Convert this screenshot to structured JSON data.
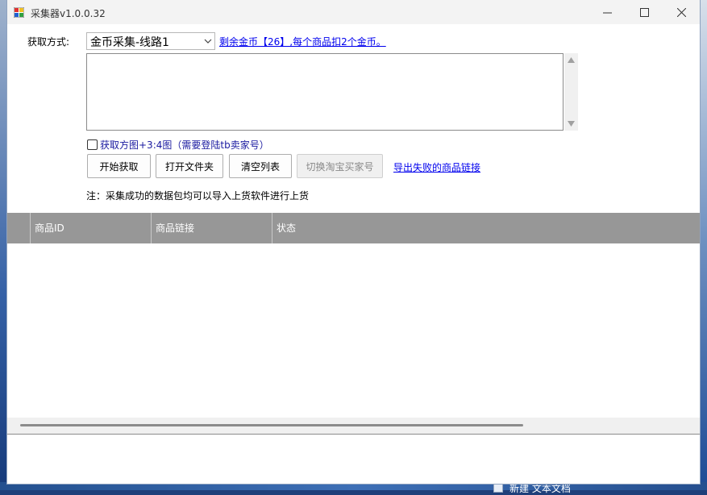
{
  "window": {
    "title": "采集器v1.0.0.32",
    "controls": {
      "minimize": "minimize-icon",
      "maximize": "maximize-icon",
      "close": "close-icon"
    }
  },
  "form": {
    "method_label": "获取方式:",
    "method_selected": "金币采集-线路1",
    "coins_link": "剩余金币【26】,每个商品扣2个金币。",
    "input_text": "",
    "checkbox_label": "获取方图+3:4图（需要登陆tb卖家号）",
    "checkbox_checked": false
  },
  "buttons": {
    "start": "开始获取",
    "open_folder": "打开文件夹",
    "clear_list": "清空列表",
    "switch_account": "切换淘宝买家号",
    "export_failed": "导出失败的商品链接"
  },
  "note": "注：采集成功的数据包均可以导入上货软件进行上货",
  "table": {
    "columns": [
      "",
      "商品ID",
      "商品链接",
      "状态"
    ],
    "rows": []
  },
  "desktop": {
    "file_label": "新建 文本文档"
  },
  "colors": {
    "link": "#0000ee",
    "grid_header": "#979797",
    "checkbox_label": "#1a1aa0"
  }
}
